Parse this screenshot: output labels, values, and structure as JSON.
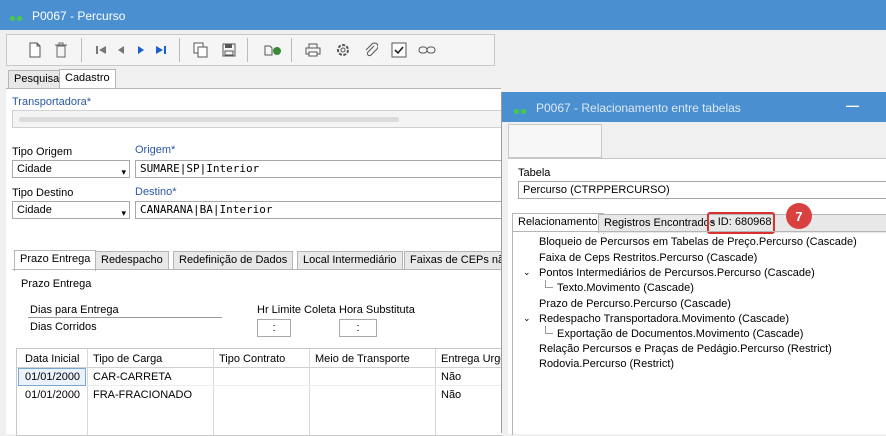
{
  "main_window": {
    "title": "P0067 - Percurso",
    "tabs": [
      "Pesquisa",
      "Cadastro"
    ],
    "transportadora_label": "Transportadora*",
    "tipo_origem_label": "Tipo Origem",
    "tipo_origem_value": "Cidade",
    "origem_label": "Origem*",
    "origem_value": "SUMARE|SP|Interior",
    "tipo_destino_label": "Tipo Destino",
    "tipo_destino_value": "Cidade",
    "destino_label": "Destino*",
    "destino_value": "CANARANA|BA|Interior",
    "sub_tabs": [
      "Prazo Entrega",
      "Redespacho",
      "Redefinição de Dados",
      "Local Intermediário",
      "Faixas de CEPs não"
    ],
    "prazo_group_label": "Prazo Entrega",
    "dias_entrega_label": "Dias para Entrega",
    "dias_entrega_value": "Dias Corridos",
    "hr_limite_label": "Hr Limite Coleta",
    "hr_limite_value": ":",
    "hora_subst_label": "Hora Substituta",
    "hora_subst_value": ":",
    "grid": {
      "columns": [
        "Data Inicial",
        "Tipo de Carga",
        "Tipo Contrato",
        "Meio de Transporte",
        "Entrega Urge"
      ],
      "rows": [
        [
          "01/01/2000",
          "CAR-CARRETA",
          "",
          "",
          "Não"
        ],
        [
          "01/01/2000",
          "FRA-FRACIONADO",
          "",
          "",
          "Não"
        ]
      ]
    }
  },
  "dialog": {
    "title": "P0067 - Relacionamento entre tabelas",
    "minimize_glyph": "—",
    "tabela_label": "Tabela",
    "tabela_value": "Percurso (CTRPPERCURSO)",
    "tabs": [
      "Relacionamento",
      "Registros Encontrados"
    ],
    "id_text": "- ID: 680968",
    "badge": "7",
    "tree": [
      "Bloqueio de Percursos em Tabelas de Preço.Percurso (Cascade)",
      "Faixa de Ceps Restritos.Percurso (Cascade)",
      "Pontos Intermediários de Percursos.Percurso (Cascade)",
      "Texto.Movimento (Cascade)",
      "Prazo de Percurso.Percurso (Cascade)",
      "Redespacho Transportadora.Movimento (Cascade)",
      "Exportação de Documentos.Movimento (Cascade)",
      "Relação Percursos e Praças de Pedágio.Percurso (Restrict)",
      "Rodovia.Percurso (Restrict)"
    ]
  }
}
